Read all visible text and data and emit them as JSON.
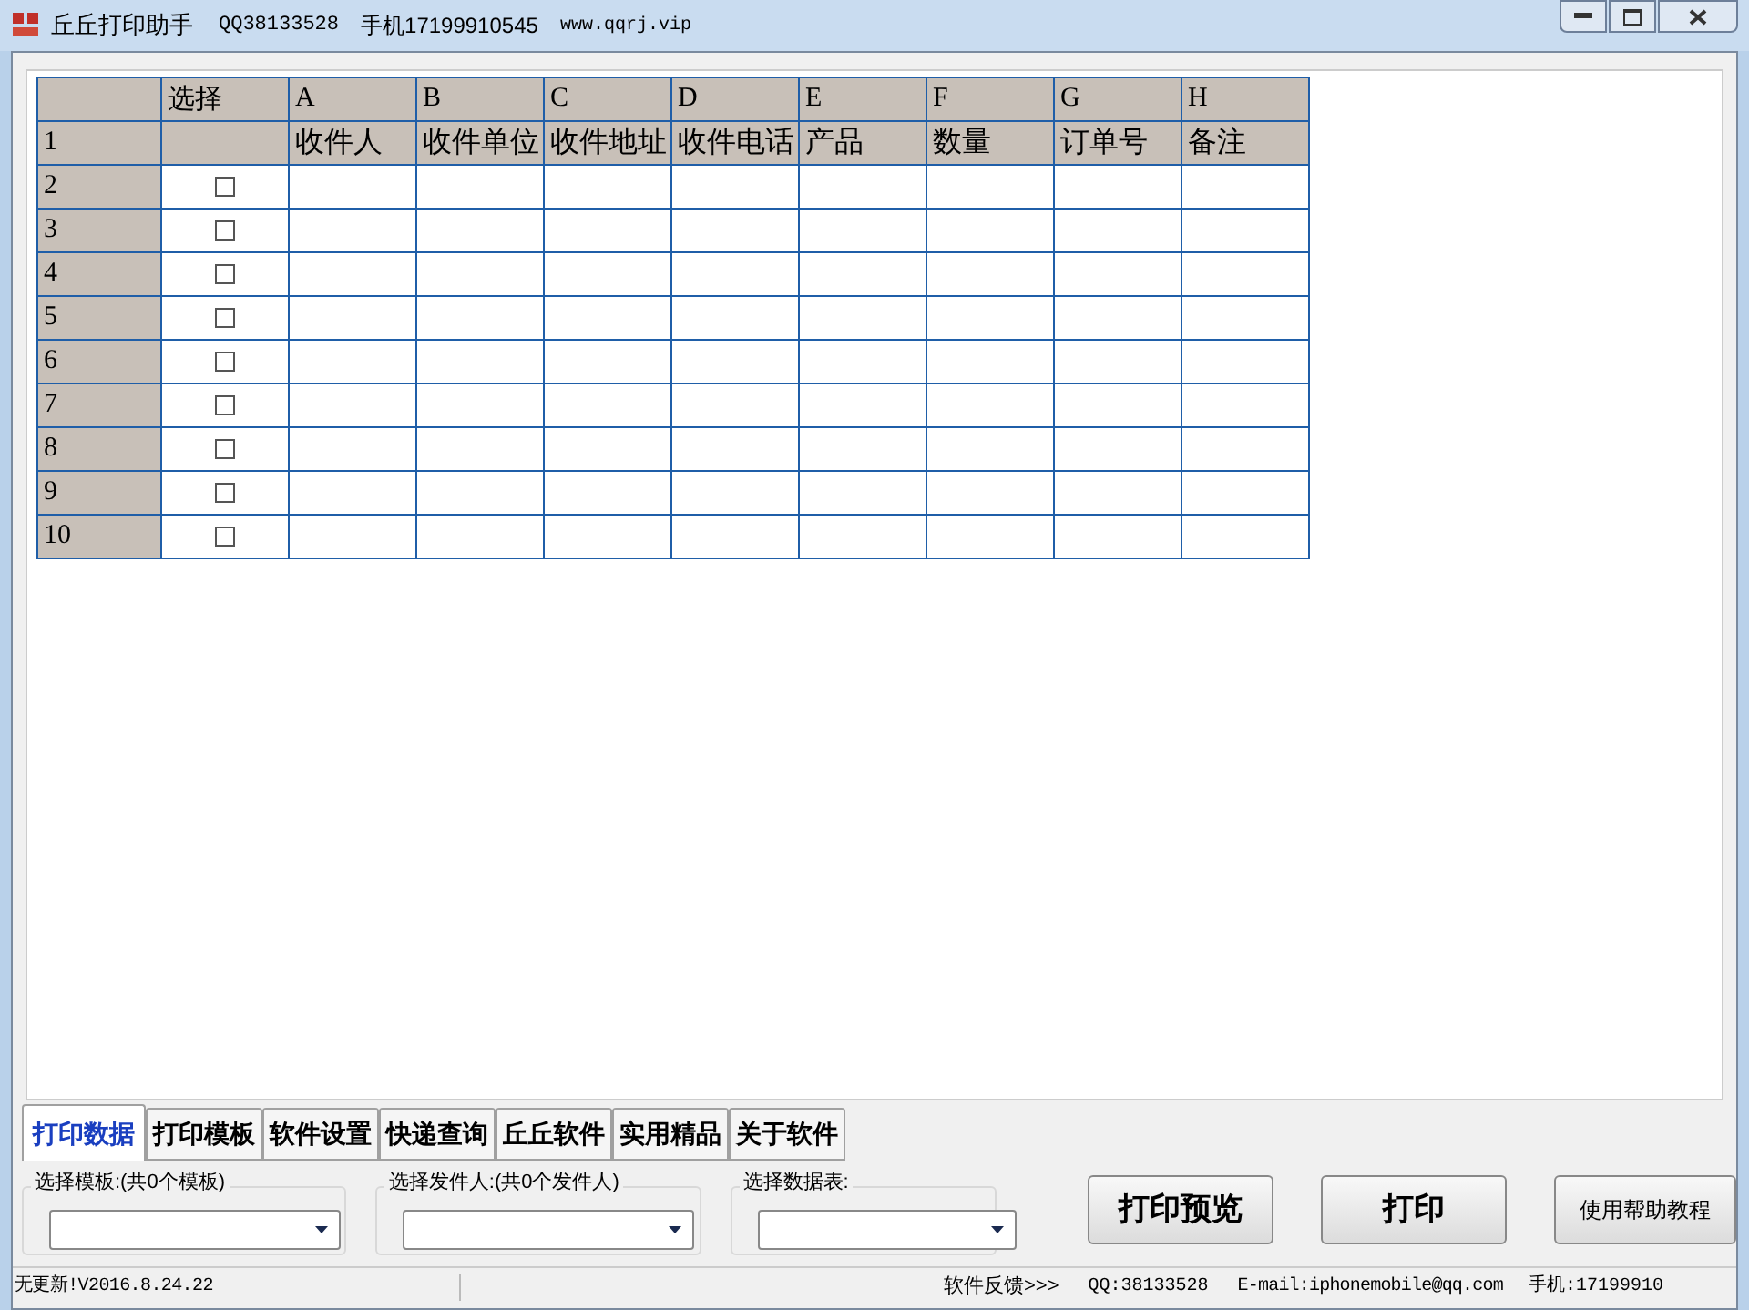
{
  "window": {
    "title": "丘丘打印助手",
    "qq": "QQ38133528",
    "phone": "手机17199910545",
    "website": "www.qqrj.vip"
  },
  "grid": {
    "header_row": [
      "选择",
      "A",
      "B",
      "C",
      "D",
      "E",
      "F",
      "G",
      "H"
    ],
    "label_row_number": "1",
    "label_row": [
      "收件人",
      "收件单位",
      "收件地址",
      "收件电话",
      "产品",
      "数量",
      "订单号",
      "备注"
    ],
    "rows": [
      {
        "number": "2",
        "checked": false
      },
      {
        "number": "3",
        "checked": false
      },
      {
        "number": "4",
        "checked": false
      },
      {
        "number": "5",
        "checked": false
      },
      {
        "number": "6",
        "checked": false
      },
      {
        "number": "7",
        "checked": false
      },
      {
        "number": "8",
        "checked": false
      },
      {
        "number": "9",
        "checked": false
      },
      {
        "number": "10",
        "checked": false
      }
    ]
  },
  "tabs": [
    {
      "label": "打印数据",
      "selected": true
    },
    {
      "label": "打印模板",
      "selected": false
    },
    {
      "label": "软件设置",
      "selected": false
    },
    {
      "label": "快递查询",
      "selected": false
    },
    {
      "label": "丘丘软件",
      "selected": false
    },
    {
      "label": "实用精品",
      "selected": false
    },
    {
      "label": "关于软件",
      "selected": false
    }
  ],
  "selectors": [
    {
      "label": "选择模板:(共0个模板)"
    },
    {
      "label": "选择发件人:(共0个发件人)"
    },
    {
      "label": "选择数据表:"
    }
  ],
  "buttons": [
    {
      "label": "打印预览",
      "kind": "large"
    },
    {
      "label": "打印",
      "kind": "large"
    },
    {
      "label": "使用帮助教程",
      "kind": "small"
    }
  ],
  "status_bar": {
    "update": "无更新!V2016.8.24.22",
    "feedback": "软件反馈>>>",
    "qq": "QQ:38133528",
    "email": "E-mail:iphonemobile@qq.com",
    "phone": "手机:17199910"
  }
}
